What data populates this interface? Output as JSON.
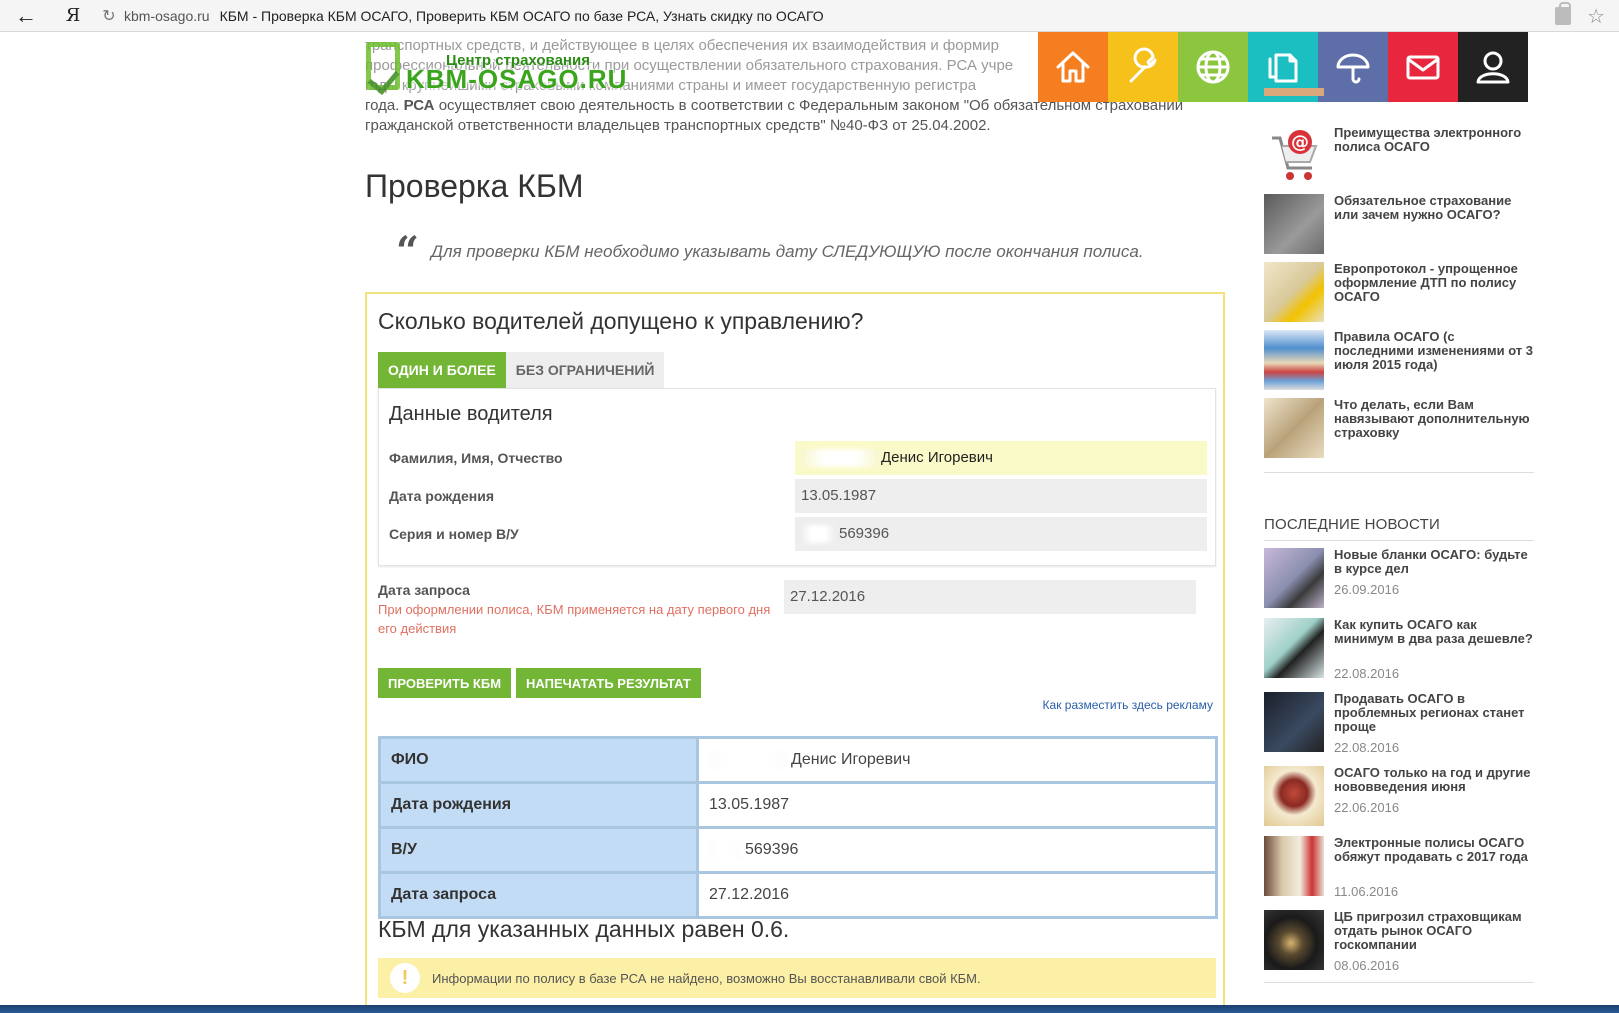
{
  "browser": {
    "back_icon": "arrow-left-icon",
    "yandex_logo": "Я",
    "url_domain": "kbm-osago.ru",
    "page_title": "КБМ - Проверка КБМ ОСАГО, Проверить КБМ ОСАГО по базе РСА, Узнать скидку по ОСАГО"
  },
  "logo": {
    "line1": "Центр страхования",
    "line2": "KBM-OSAGO.RU"
  },
  "intro": {
    "line1": "транспортных средств, и действующее в целях обеспечения их взаимодействия и формир",
    "line2": "профессиональной деятельности при осуществлении обязательного страхования. РСА учре",
    "line3": "годы крупнейшими страховыми компаниями страны и имеет государственную регистра",
    "line4_a": "года. ",
    "line4_b": "РСА",
    "line4_c": " осуществляет свою деятельность в соответствии с Федеральным законом \"Об обязательном страховании",
    "line5": "гражданской ответственности владельцев транспортных средств\" №40-ФЗ от 25.04.2002."
  },
  "nav": {
    "tiles": [
      {
        "name": "home",
        "color": "#f57f20"
      },
      {
        "name": "wrench",
        "color": "#f6c11b"
      },
      {
        "name": "globe",
        "color": "#8cc63f"
      },
      {
        "name": "documents",
        "color": "#1bbfc1"
      },
      {
        "name": "umbrella",
        "color": "#5d6ea8"
      },
      {
        "name": "mail",
        "color": "#e8263d"
      },
      {
        "name": "user",
        "color": "#222222"
      }
    ]
  },
  "main": {
    "title": "Проверка КБМ",
    "quote": "Для проверки КБМ необходимо указывать дату СЛЕДУЮЩУЮ после окончания полиса.",
    "question": "Сколько водителей допущено к управлению?",
    "tab_one": "ОДИН И БОЛЕЕ",
    "tab_unlimited": "БЕЗ ОГРАНИЧЕНИЙ",
    "driver_heading": "Данные водителя",
    "fio_label": "Фамилия, Имя, Отчество",
    "fio_value": "Денис Игоревич",
    "birth_label": "Дата рождения",
    "birth_value": "13.05.1987",
    "license_label": "Серия и номер В/У",
    "license_value": "569396",
    "request_label": "Дата запроса",
    "request_note": "При оформлении полиса, КБМ применяется на дату первого дня его действия",
    "request_value": "27.12.2016",
    "btn_check": "ПРОВЕРИТЬ КБМ",
    "btn_print": "НАПЕЧАТАТЬ РЕЗУЛЬТАТ",
    "ad_link": "Как разместить здесь рекламу"
  },
  "result": {
    "rows": [
      {
        "label": "ФИО",
        "value": "Денис Игоревич"
      },
      {
        "label": "Дата рождения",
        "value": "13.05.1987"
      },
      {
        "label": "В/У",
        "value": "569396"
      },
      {
        "label": "Дата запроса",
        "value": "27.12.2016"
      }
    ],
    "summary": "КБМ для указанных данных равен 0.6.",
    "info": "Информации по полису в базе РСА не найдено, возможно Вы восстанавливали свой КБМ."
  },
  "sidebar": {
    "articles": [
      {
        "title": "Преимущества электронного полиса ОСАГО"
      },
      {
        "title": "Обязательное страхование или зачем нужно ОСАГО?"
      },
      {
        "title": "Европротокол - упрощенное оформление ДТП по полису ОСАГО"
      },
      {
        "title": "Правила ОСАГО (с последними изменениями от 3 июля 2015 года)"
      },
      {
        "title": "Что делать, если Вам навязывают дополнительную страховку"
      }
    ],
    "news_heading": "ПОСЛЕДНИЕ НОВОСТИ",
    "news": [
      {
        "title": "Новые бланки ОСАГО: будьте в курсе дел",
        "date": "26.09.2016"
      },
      {
        "title": "Как купить ОСАГО как минимум в два раза дешевле?",
        "date": "22.08.2016"
      },
      {
        "title": "Продавать ОСАГО в проблемных регионах станет проще",
        "date": "22.08.2016"
      },
      {
        "title": "ОСАГО только на год и другие нововведения июня",
        "date": "22.06.2016"
      },
      {
        "title": "Электронные полисы ОСАГО обяжут продавать с 2017 года",
        "date": "11.06.2016"
      },
      {
        "title": "ЦБ пригрозил страховщикам отдать рынок ОСАГО госкомпании",
        "date": "08.06.2016"
      }
    ]
  }
}
